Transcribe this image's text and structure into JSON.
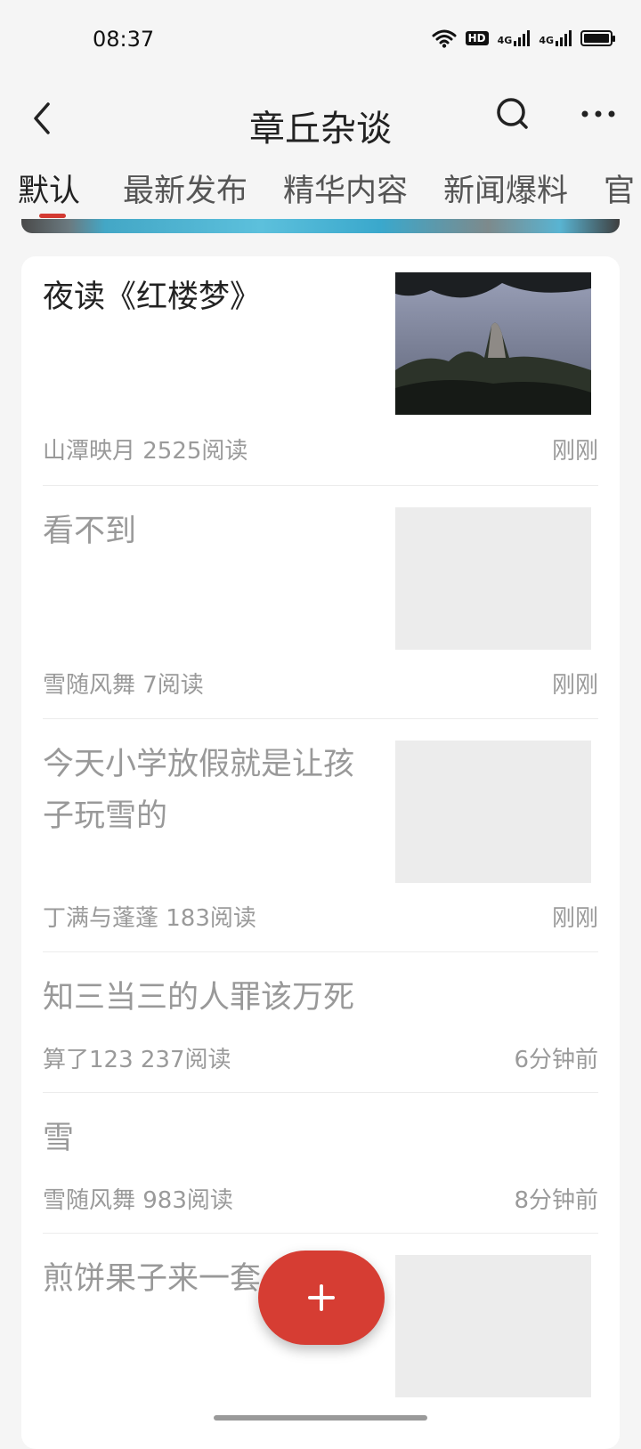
{
  "status": {
    "time": "08:37",
    "hd_label": "HD",
    "net1": "4G",
    "net2": "4G"
  },
  "header": {
    "title": "章丘杂谈"
  },
  "tabs": [
    {
      "label": "默认",
      "active": true
    },
    {
      "label": "最新发布"
    },
    {
      "label": "精华内容"
    },
    {
      "label": "新闻爆料"
    },
    {
      "label": "官"
    }
  ],
  "posts": [
    {
      "title": "夜读《红楼梦》",
      "author_reads": "山潭映月 2525阅读",
      "time": "刚刚",
      "thumb": "landscape-photo"
    },
    {
      "title": "看不到",
      "author_reads": "雪随风舞 7阅读",
      "time": "刚刚",
      "thumb": "placeholder"
    },
    {
      "title": "今天小学放假就是让孩子玩雪的",
      "author_reads": "丁满与蓬蓬 183阅读",
      "time": "刚刚",
      "thumb": "placeholder"
    },
    {
      "title": "知三当三的人罪该万死",
      "author_reads": "算了123 237阅读",
      "time": "6分钟前"
    },
    {
      "title": "雪",
      "author_reads": "雪随风舞 983阅读",
      "time": "8分钟前"
    },
    {
      "title": "煎饼果子来一套",
      "thumb": "placeholder"
    }
  ],
  "colors": {
    "accent": "#d63d33",
    "placeholder": "#ececec",
    "meta_text": "#9a9a9a"
  },
  "icons": [
    "back-icon",
    "search-icon",
    "more-icon",
    "plus-icon",
    "wifi-icon",
    "battery-icon"
  ]
}
